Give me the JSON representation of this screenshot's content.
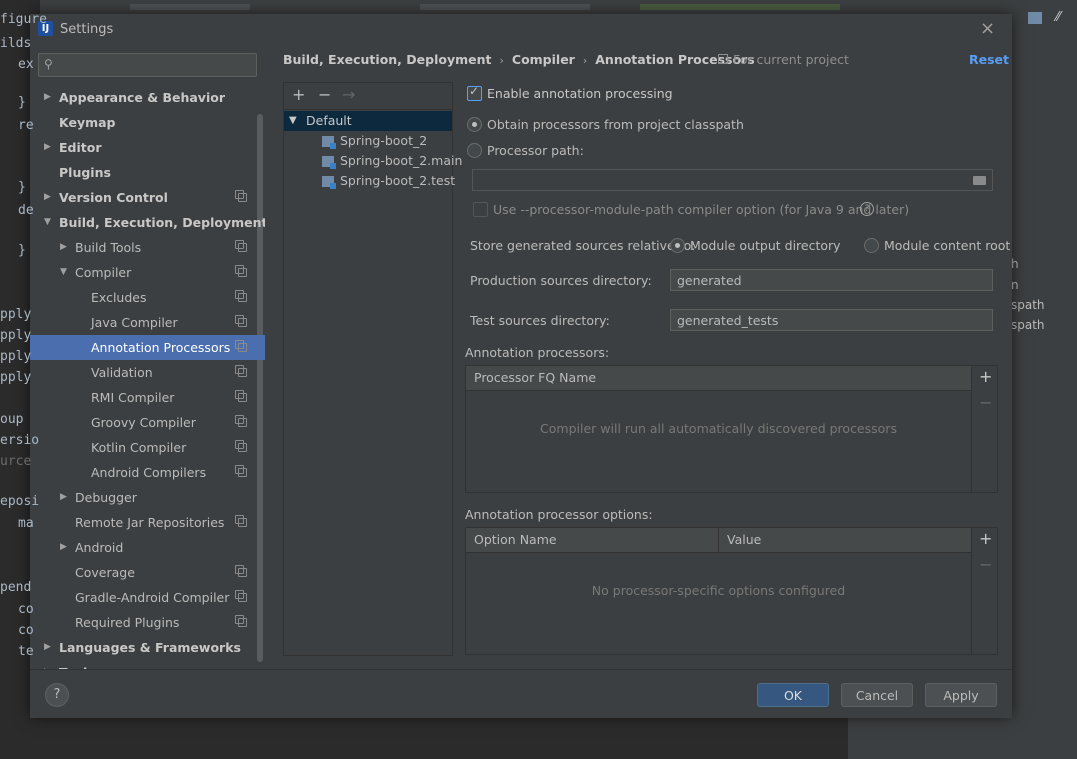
{
  "background": {
    "code_fragments": [
      "figure",
      "ilds",
      "ex",
      "}",
      "re",
      "}",
      "de",
      "}",
      "pply",
      "pply",
      "pply",
      "pply",
      "oup",
      "ersio",
      "urce",
      "eposi",
      "ma",
      "pend",
      "co",
      "co",
      "te"
    ],
    "right_panel_fragments": [
      "h",
      "n",
      "spath",
      "spath"
    ]
  },
  "dialog": {
    "title": "Settings",
    "close_label": "×"
  },
  "search": {
    "placeholder": ""
  },
  "tree": {
    "items": [
      {
        "label": "Appearance & Behavior",
        "level": 0,
        "expander": "collapsed",
        "bold": true,
        "project_icon": false,
        "selected": false
      },
      {
        "label": "Keymap",
        "level": 0,
        "expander": "none",
        "bold": true,
        "project_icon": false,
        "selected": false
      },
      {
        "label": "Editor",
        "level": 0,
        "expander": "collapsed",
        "bold": true,
        "project_icon": false,
        "selected": false
      },
      {
        "label": "Plugins",
        "level": 0,
        "expander": "none",
        "bold": true,
        "project_icon": false,
        "selected": false
      },
      {
        "label": "Version Control",
        "level": 0,
        "expander": "collapsed",
        "bold": true,
        "project_icon": true,
        "selected": false
      },
      {
        "label": "Build, Execution, Deployment",
        "level": 0,
        "expander": "expanded",
        "bold": true,
        "project_icon": false,
        "selected": false
      },
      {
        "label": "Build Tools",
        "level": 1,
        "expander": "collapsed",
        "bold": false,
        "project_icon": true,
        "selected": false
      },
      {
        "label": "Compiler",
        "level": 1,
        "expander": "expanded",
        "bold": false,
        "project_icon": true,
        "selected": false
      },
      {
        "label": "Excludes",
        "level": 2,
        "expander": "none",
        "bold": false,
        "project_icon": true,
        "selected": false
      },
      {
        "label": "Java Compiler",
        "level": 2,
        "expander": "none",
        "bold": false,
        "project_icon": true,
        "selected": false
      },
      {
        "label": "Annotation Processors",
        "level": 2,
        "expander": "none",
        "bold": false,
        "project_icon": true,
        "selected": true
      },
      {
        "label": "Validation",
        "level": 2,
        "expander": "none",
        "bold": false,
        "project_icon": true,
        "selected": false
      },
      {
        "label": "RMI Compiler",
        "level": 2,
        "expander": "none",
        "bold": false,
        "project_icon": true,
        "selected": false
      },
      {
        "label": "Groovy Compiler",
        "level": 2,
        "expander": "none",
        "bold": false,
        "project_icon": true,
        "selected": false
      },
      {
        "label": "Kotlin Compiler",
        "level": 2,
        "expander": "none",
        "bold": false,
        "project_icon": true,
        "selected": false
      },
      {
        "label": "Android Compilers",
        "level": 2,
        "expander": "none",
        "bold": false,
        "project_icon": true,
        "selected": false
      },
      {
        "label": "Debugger",
        "level": 1,
        "expander": "collapsed",
        "bold": false,
        "project_icon": false,
        "selected": false
      },
      {
        "label": "Remote Jar Repositories",
        "level": 1,
        "expander": "none",
        "bold": false,
        "project_icon": true,
        "selected": false
      },
      {
        "label": "Android",
        "level": 1,
        "expander": "collapsed",
        "bold": false,
        "project_icon": false,
        "selected": false
      },
      {
        "label": "Coverage",
        "level": 1,
        "expander": "none",
        "bold": false,
        "project_icon": true,
        "selected": false
      },
      {
        "label": "Gradle-Android Compiler",
        "level": 1,
        "expander": "none",
        "bold": false,
        "project_icon": true,
        "selected": false
      },
      {
        "label": "Required Plugins",
        "level": 1,
        "expander": "none",
        "bold": false,
        "project_icon": true,
        "selected": false
      },
      {
        "label": "Languages & Frameworks",
        "level": 0,
        "expander": "collapsed",
        "bold": true,
        "project_icon": false,
        "selected": false
      },
      {
        "label": "Tools",
        "level": 0,
        "expander": "collapsed",
        "bold": true,
        "project_icon": false,
        "selected": false
      }
    ]
  },
  "header": {
    "breadcrumb": [
      "Build, Execution, Deployment",
      "Compiler",
      "Annotation Processors"
    ],
    "breadcrumb_sep": "›",
    "for_project": "For current project",
    "reset": "Reset"
  },
  "profiles": {
    "toolbar": {
      "add": "+",
      "remove": "−",
      "move": "→"
    },
    "root": "Default",
    "modules": [
      "Spring-boot_2",
      "Spring-boot_2.main",
      "Spring-boot_2.test"
    ]
  },
  "options": {
    "enable_processing": {
      "label": "Enable annotation processing",
      "checked": true
    },
    "obtain_from_classpath": {
      "label": "Obtain processors from project classpath",
      "selected": true
    },
    "processor_path": {
      "label": "Processor path:",
      "selected": false,
      "value": ""
    },
    "module_path_option": {
      "label": "Use --processor-module-path compiler option (for Java 9 and later)",
      "checked": false
    },
    "store_relative": {
      "label": "Store generated sources relative to:",
      "module_output": "Module output directory",
      "module_content": "Module content root",
      "selected": "module_output"
    },
    "production_dir": {
      "label": "Production sources directory:",
      "value": "generated"
    },
    "test_dir": {
      "label": "Test sources directory:",
      "value": "generated_tests"
    }
  },
  "processors_table": {
    "title": "Annotation processors:",
    "columns": [
      "Processor FQ Name"
    ],
    "empty_text": "Compiler will run all automatically discovered processors",
    "add": "+",
    "remove": "−"
  },
  "options_table": {
    "title": "Annotation processor options:",
    "columns": [
      "Option Name",
      "Value"
    ],
    "empty_text": "No processor-specific options configured",
    "add": "+",
    "remove": "−"
  },
  "footer": {
    "help": "?",
    "ok": "OK",
    "cancel": "Cancel",
    "apply": "Apply"
  },
  "colors": {
    "selection": "#4b6eaf",
    "primary_button": "#365880",
    "link": "#589df6",
    "panel": "#3c3f41"
  }
}
